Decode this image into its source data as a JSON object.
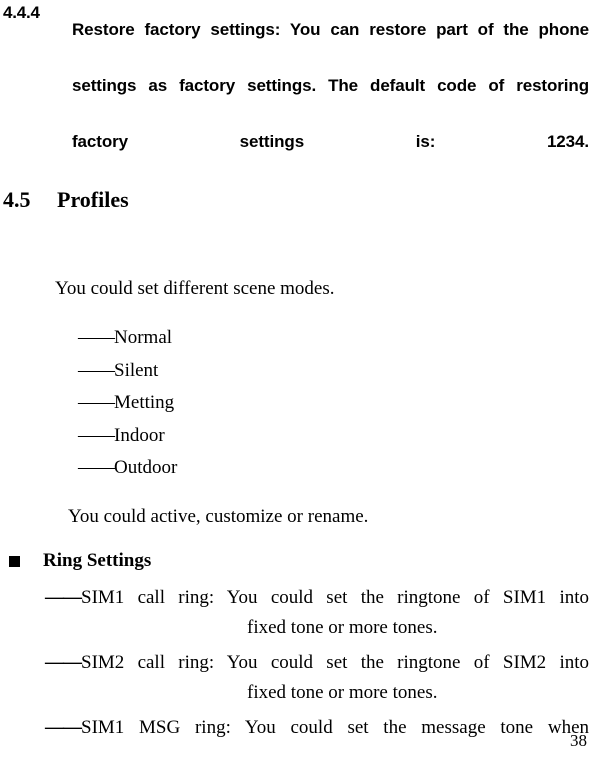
{
  "page": {
    "number": "38"
  },
  "subsection": {
    "number": "4.4.4",
    "text": "Restore factory settings: You can restore part of the phone settings as factory settings. The default code of restoring factory settings is: 1234."
  },
  "section": {
    "number": "4.5",
    "title": "Profiles"
  },
  "intro_paragraph": "You could set different scene modes.",
  "scene_modes": {
    "dash_prefix": "——",
    "items": [
      {
        "label": "Normal"
      },
      {
        "label": "Silent"
      },
      {
        "label": "Metting"
      },
      {
        "label": "Indoor"
      },
      {
        "label": "Outdoor"
      }
    ]
  },
  "outro_paragraph": "You could active, customize or rename.",
  "ring_settings": {
    "bullet_glyph": "square-bullet",
    "heading": "Ring Settings",
    "dash_prefix": "——",
    "entries": [
      {
        "line1": "SIM1 call ring: You could set the ringtone of SIM1 into",
        "line2": "fixed tone or more tones."
      },
      {
        "line1": "SIM2 call ring: You could set the ringtone of SIM2 into",
        "line2": "fixed tone or more tones."
      },
      {
        "line1": "SIM1 MSG ring: You could set the message tone when",
        "line2": ""
      }
    ]
  },
  "colors": {
    "text": "#000000",
    "background": "#ffffff"
  }
}
